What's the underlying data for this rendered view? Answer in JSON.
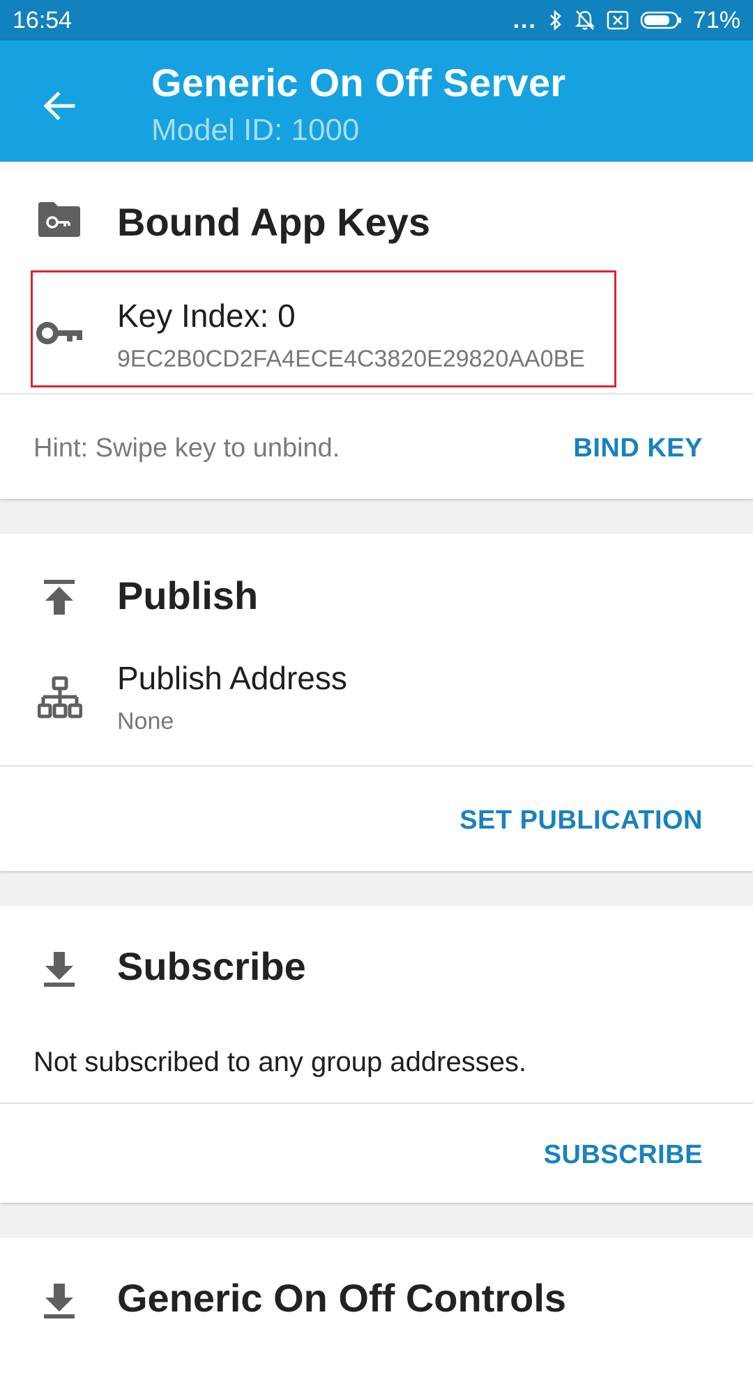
{
  "status_bar": {
    "time": "16:54",
    "dots": "...",
    "battery_percent": "71%"
  },
  "app_bar": {
    "title": "Generic On Off Server",
    "subtitle": "Model ID: 1000"
  },
  "bound_app_keys": {
    "title": "Bound App Keys",
    "key": {
      "label": "Key Index: 0",
      "value": "9EC2B0CD2FA4ECE4C3820E29820AA0BE"
    },
    "hint": "Hint: Swipe key to unbind.",
    "bind_button": "BIND KEY"
  },
  "publish": {
    "title": "Publish",
    "address_label": "Publish Address",
    "address_value": "None",
    "set_button": "SET PUBLICATION"
  },
  "subscribe": {
    "title": "Subscribe",
    "message": "Not subscribed to any group addresses.",
    "subscribe_button": "SUBSCRIBE"
  },
  "controls": {
    "title": "Generic On Off Controls"
  },
  "colors": {
    "status_bar": "#1182be",
    "app_bar": "#16a2e0",
    "accent": "#1782bf",
    "highlight": "#d6262c"
  }
}
